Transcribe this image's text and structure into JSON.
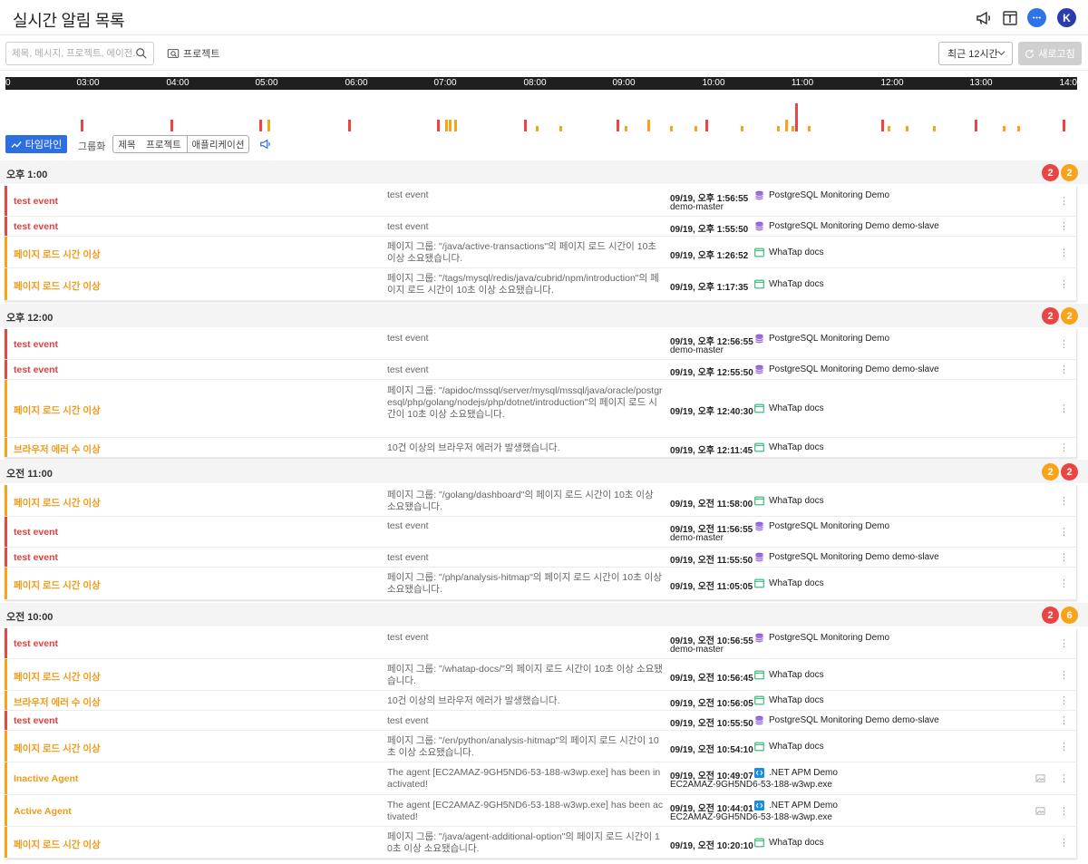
{
  "header": {
    "title": "실시간 알림 목록",
    "icons": [
      "megaphone-icon",
      "info-panel-icon",
      "chat-icon"
    ],
    "avatar_letter": "K"
  },
  "toolbar": {
    "search_placeholder": "제목, 메시지, 프로젝트, 에이전...",
    "project_filter_label": "프로젝트",
    "range_label": "최근 12시간",
    "refresh_label": "새로고침"
  },
  "timeline": {
    "ticks": [
      "0",
      "03:00",
      "04:00",
      "05:00",
      "06:00",
      "07:00",
      "08:00",
      "09:00",
      "10:00",
      "11:00",
      "12:00",
      "13:00",
      "14:0"
    ]
  },
  "view": {
    "timeline_label": "타임라인",
    "group_label": "그룹화",
    "group_options": [
      "제목",
      "프로젝트",
      "애플리케이션"
    ]
  },
  "groups": [
    {
      "time": "오후 1:00",
      "badges": [
        {
          "count": "2",
          "color": "red"
        },
        {
          "count": "2",
          "color": "orange"
        }
      ],
      "rows": [
        {
          "level": "red",
          "title": "test event",
          "msg": "test event",
          "time": "09/19, 오후 1:56:55",
          "project": "PostgreSQL Monitoring Demo",
          "icon": "db",
          "agent": "demo-master",
          "agent_pos": "below"
        },
        {
          "level": "red",
          "title": "test event",
          "msg": "test event",
          "time": "09/19, 오후 1:55:50",
          "project": "PostgreSQL Monitoring Demo",
          "icon": "db",
          "agent": "demo-slave",
          "agent_pos": "inline"
        },
        {
          "level": "orange",
          "title": "페이지 로드 시간 이상",
          "msg": "페이지 그룹: \"/java/active-transactions\"의 페이지 로드 시간이 10초 이상 소요됐습니다.",
          "time": "09/19, 오후 1:26:52",
          "project": "WhaTap docs",
          "icon": "browser",
          "agent": "",
          "agent_pos": "none"
        },
        {
          "level": "orange",
          "title": "페이지 로드 시간 이상",
          "msg": "페이지 그룹: \"/tags/mysql/redis/java/cubrid/npm/introduction\"의 페이지 로드 시간이 10초 이상 소요됐습니다.",
          "time": "09/19, 오후 1:17:35",
          "project": "WhaTap docs",
          "icon": "browser",
          "agent": "",
          "agent_pos": "none"
        }
      ]
    },
    {
      "time": "오후 12:00",
      "badges": [
        {
          "count": "2",
          "color": "red"
        },
        {
          "count": "2",
          "color": "orange"
        }
      ],
      "rows": [
        {
          "level": "red",
          "title": "test event",
          "msg": "test event",
          "time": "09/19, 오후 12:56:55",
          "project": "PostgreSQL Monitoring Demo",
          "icon": "db",
          "agent": "demo-master",
          "agent_pos": "below"
        },
        {
          "level": "red",
          "title": "test event",
          "msg": "test event",
          "time": "09/19, 오후 12:55:50",
          "project": "PostgreSQL Monitoring Demo",
          "icon": "db",
          "agent": "demo-slave",
          "agent_pos": "inline"
        },
        {
          "level": "orange",
          "title": "페이지 로드 시간 이상",
          "msg": "페이지 그룹: \"/apidoc/mssql/server/mysql/mssql/java/oracle/postgresql/php/golang/nodejs/php/dotnet/introduction\"의 페이지 로드 시간이 10초 이상 소요됐습니다.",
          "time": "09/19, 오후 12:40:30",
          "project": "WhaTap docs",
          "icon": "browser",
          "agent": "",
          "agent_pos": "none"
        },
        {
          "level": "orange",
          "title": "브라우저 에러 수 이상",
          "msg": "10건 이상의 브라우저 에러가 발생했습니다.",
          "time": "09/19, 오후 12:11:45",
          "project": "WhaTap docs",
          "icon": "browser",
          "agent": "",
          "agent_pos": "none"
        }
      ]
    },
    {
      "time": "오전 11:00",
      "badges": [
        {
          "count": "2",
          "color": "orange"
        },
        {
          "count": "2",
          "color": "red"
        }
      ],
      "rows": [
        {
          "level": "orange",
          "title": "페이지 로드 시간 이상",
          "msg": "페이지 그룹: \"/golang/dashboard\"의 페이지 로드 시간이 10초 이상 소요됐습니다.",
          "time": "09/19, 오전 11:58:00",
          "project": "WhaTap docs",
          "icon": "browser",
          "agent": "",
          "agent_pos": "none"
        },
        {
          "level": "red",
          "title": "test event",
          "msg": "test event",
          "time": "09/19, 오전 11:56:55",
          "project": "PostgreSQL Monitoring Demo",
          "icon": "db",
          "agent": "demo-master",
          "agent_pos": "below"
        },
        {
          "level": "red",
          "title": "test event",
          "msg": "test event",
          "time": "09/19, 오전 11:55:50",
          "project": "PostgreSQL Monitoring Demo",
          "icon": "db",
          "agent": "demo-slave",
          "agent_pos": "inline"
        },
        {
          "level": "orange",
          "title": "페이지 로드 시간 이상",
          "msg": "페이지 그룹: \"/php/analysis-hitmap\"의 페이지 로드 시간이 10초 이상 소요됐습니다.",
          "time": "09/19, 오전 11:05:05",
          "project": "WhaTap docs",
          "icon": "browser",
          "agent": "",
          "agent_pos": "none"
        }
      ]
    },
    {
      "time": "오전 10:00",
      "badges": [
        {
          "count": "2",
          "color": "red"
        },
        {
          "count": "6",
          "color": "orange"
        }
      ],
      "rows": [
        {
          "level": "red",
          "title": "test event",
          "msg": "test event",
          "time": "09/19, 오전 10:56:55",
          "project": "PostgreSQL Monitoring Demo",
          "icon": "db",
          "agent": "demo-master",
          "agent_pos": "below"
        },
        {
          "level": "orange",
          "title": "페이지 로드 시간 이상",
          "msg": "페이지 그룹: \"/whatap-docs/\"의 페이지 로드 시간이 10초 이상 소요됐습니다.",
          "time": "09/19, 오전 10:56:45",
          "project": "WhaTap docs",
          "icon": "browser",
          "agent": "",
          "agent_pos": "none"
        },
        {
          "level": "orange",
          "title": "브라우저 에러 수 이상",
          "msg": "10건 이상의 브라우저 에러가 발생했습니다.",
          "time": "09/19, 오전 10:56:05",
          "project": "WhaTap docs",
          "icon": "browser",
          "agent": "",
          "agent_pos": "none"
        },
        {
          "level": "red",
          "title": "test event",
          "msg": "test event",
          "time": "09/19, 오전 10:55:50",
          "project": "PostgreSQL Monitoring Demo",
          "icon": "db",
          "agent": "demo-slave",
          "agent_pos": "inline"
        },
        {
          "level": "orange",
          "title": "페이지 로드 시간 이상",
          "msg": "페이지 그룹: \"/en/python/analysis-hitmap\"의 페이지 로드 시간이 10초 이상 소요됐습니다.",
          "time": "09/19, 오전 10:54:10",
          "project": "WhaTap docs",
          "icon": "browser",
          "agent": "",
          "agent_pos": "none"
        },
        {
          "level": "orange",
          "title": "Inactive Agent",
          "msg": "The agent [EC2AMAZ-9GH5ND6-53-188-w3wp.exe] has been inactivated!",
          "time": "09/19, 오전 10:49:07",
          "project": ".NET APM Demo",
          "icon": "code",
          "agent": "EC2AMAZ-9GH5ND6-53-188-w3wp.exe",
          "agent_pos": "below",
          "has_image": true
        },
        {
          "level": "orange",
          "title": "Active Agent",
          "msg": "The agent [EC2AMAZ-9GH5ND6-53-188-w3wp.exe] has been activated!",
          "time": "09/19, 오전 10:44:01",
          "project": ".NET APM Demo",
          "icon": "code",
          "agent": "EC2AMAZ-9GH5ND6-53-188-w3wp.exe",
          "agent_pos": "below",
          "has_image": true
        },
        {
          "level": "orange",
          "title": "페이지 로드 시간 이상",
          "msg": "페이지 그룹: \"/java/agent-additional-option\"의 페이지 로드 시간이 10초 이상 소요됐습니다.",
          "time": "09/19, 오전 10:20:10",
          "project": "WhaTap docs",
          "icon": "browser",
          "agent": "",
          "agent_pos": "none"
        }
      ]
    }
  ],
  "colors": {
    "critical": "#ea4545",
    "warning": "#f7a41a",
    "accent": "#2e6fe0",
    "avatar": "#2b3cad"
  }
}
